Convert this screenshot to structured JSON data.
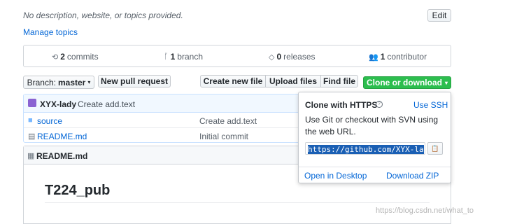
{
  "repo": {
    "description": "No description, website, or topics provided.",
    "edit_label": "Edit",
    "manage_topics": "Manage topics"
  },
  "summary": {
    "commits_count": "2",
    "commits_label": "commits",
    "branch_count": "1",
    "branch_label": "branch",
    "releases_count": "0",
    "releases_label": "releases",
    "contributors_count": "1",
    "contributors_label": "contributor"
  },
  "toolbar": {
    "branch_prefix": "Branch:",
    "branch_name": "master",
    "new_pull_request": "New pull request",
    "create_new_file": "Create new file",
    "upload_files": "Upload files",
    "find_file": "Find file",
    "clone_or_download": "Clone or download"
  },
  "commit": {
    "author": "XYX-lady",
    "message": "Create add.text"
  },
  "files": [
    {
      "name": "source",
      "type": "folder",
      "commit": "Create add.text"
    },
    {
      "name": "README.md",
      "type": "file",
      "commit": "Initial commit"
    }
  ],
  "readme": {
    "header": "README.md",
    "heading": "T224_pub"
  },
  "clone_popover": {
    "title": "Clone with HTTPS",
    "use_ssh": "Use SSH",
    "description": "Use Git or checkout with SVN using the web URL.",
    "url": "https://github.com/XYX-la",
    "open_desktop": "Open in Desktop",
    "download_zip": "Download ZIP"
  },
  "watermark": "https://blog.csdn.net/what_to",
  "colors": {
    "accent": "#0366d6",
    "green_button": "#28a745",
    "border": "#d1d5da"
  },
  "icons": [
    "history-icon",
    "branch-icon",
    "tag-icon",
    "people-icon",
    "avatar",
    "folder-icon",
    "file-icon",
    "book-icon",
    "question-icon",
    "clipboard-icon",
    "caret-down-icon"
  ]
}
